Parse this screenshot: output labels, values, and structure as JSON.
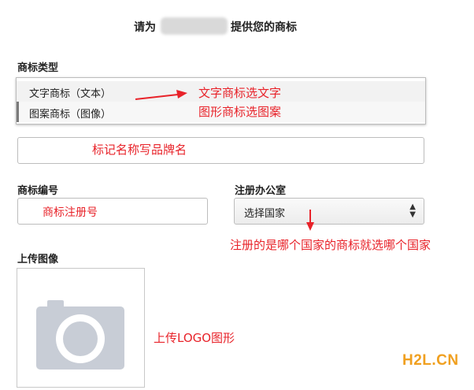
{
  "header": {
    "title_prefix": "请为",
    "title_suffix": "提供您的商标"
  },
  "trademark_type": {
    "label": "商标类型",
    "options": [
      "文字商标（文本）",
      "图案商标（图像）"
    ]
  },
  "trademark_name": {
    "input_value": ""
  },
  "trademark_number": {
    "label": "商标编号",
    "input_value": ""
  },
  "registration_office": {
    "label": "注册办公室",
    "selected": "选择国家"
  },
  "upload": {
    "label": "上传图像",
    "icon": "camera-icon"
  },
  "annotations": {
    "type_hint_1": "文字商标选文字",
    "type_hint_2": "图形商标选图案",
    "name_hint": "标记名称写品牌名",
    "number_hint": "商标注册号",
    "office_hint": "注册的是哪个国家的商标就选哪个国家",
    "upload_hint": "上传LOGO图形"
  },
  "watermark": "H2L.CN",
  "colors": {
    "annotation": "#e8232a",
    "watermark": "#f0a020",
    "camera": "#c8cdd6"
  }
}
